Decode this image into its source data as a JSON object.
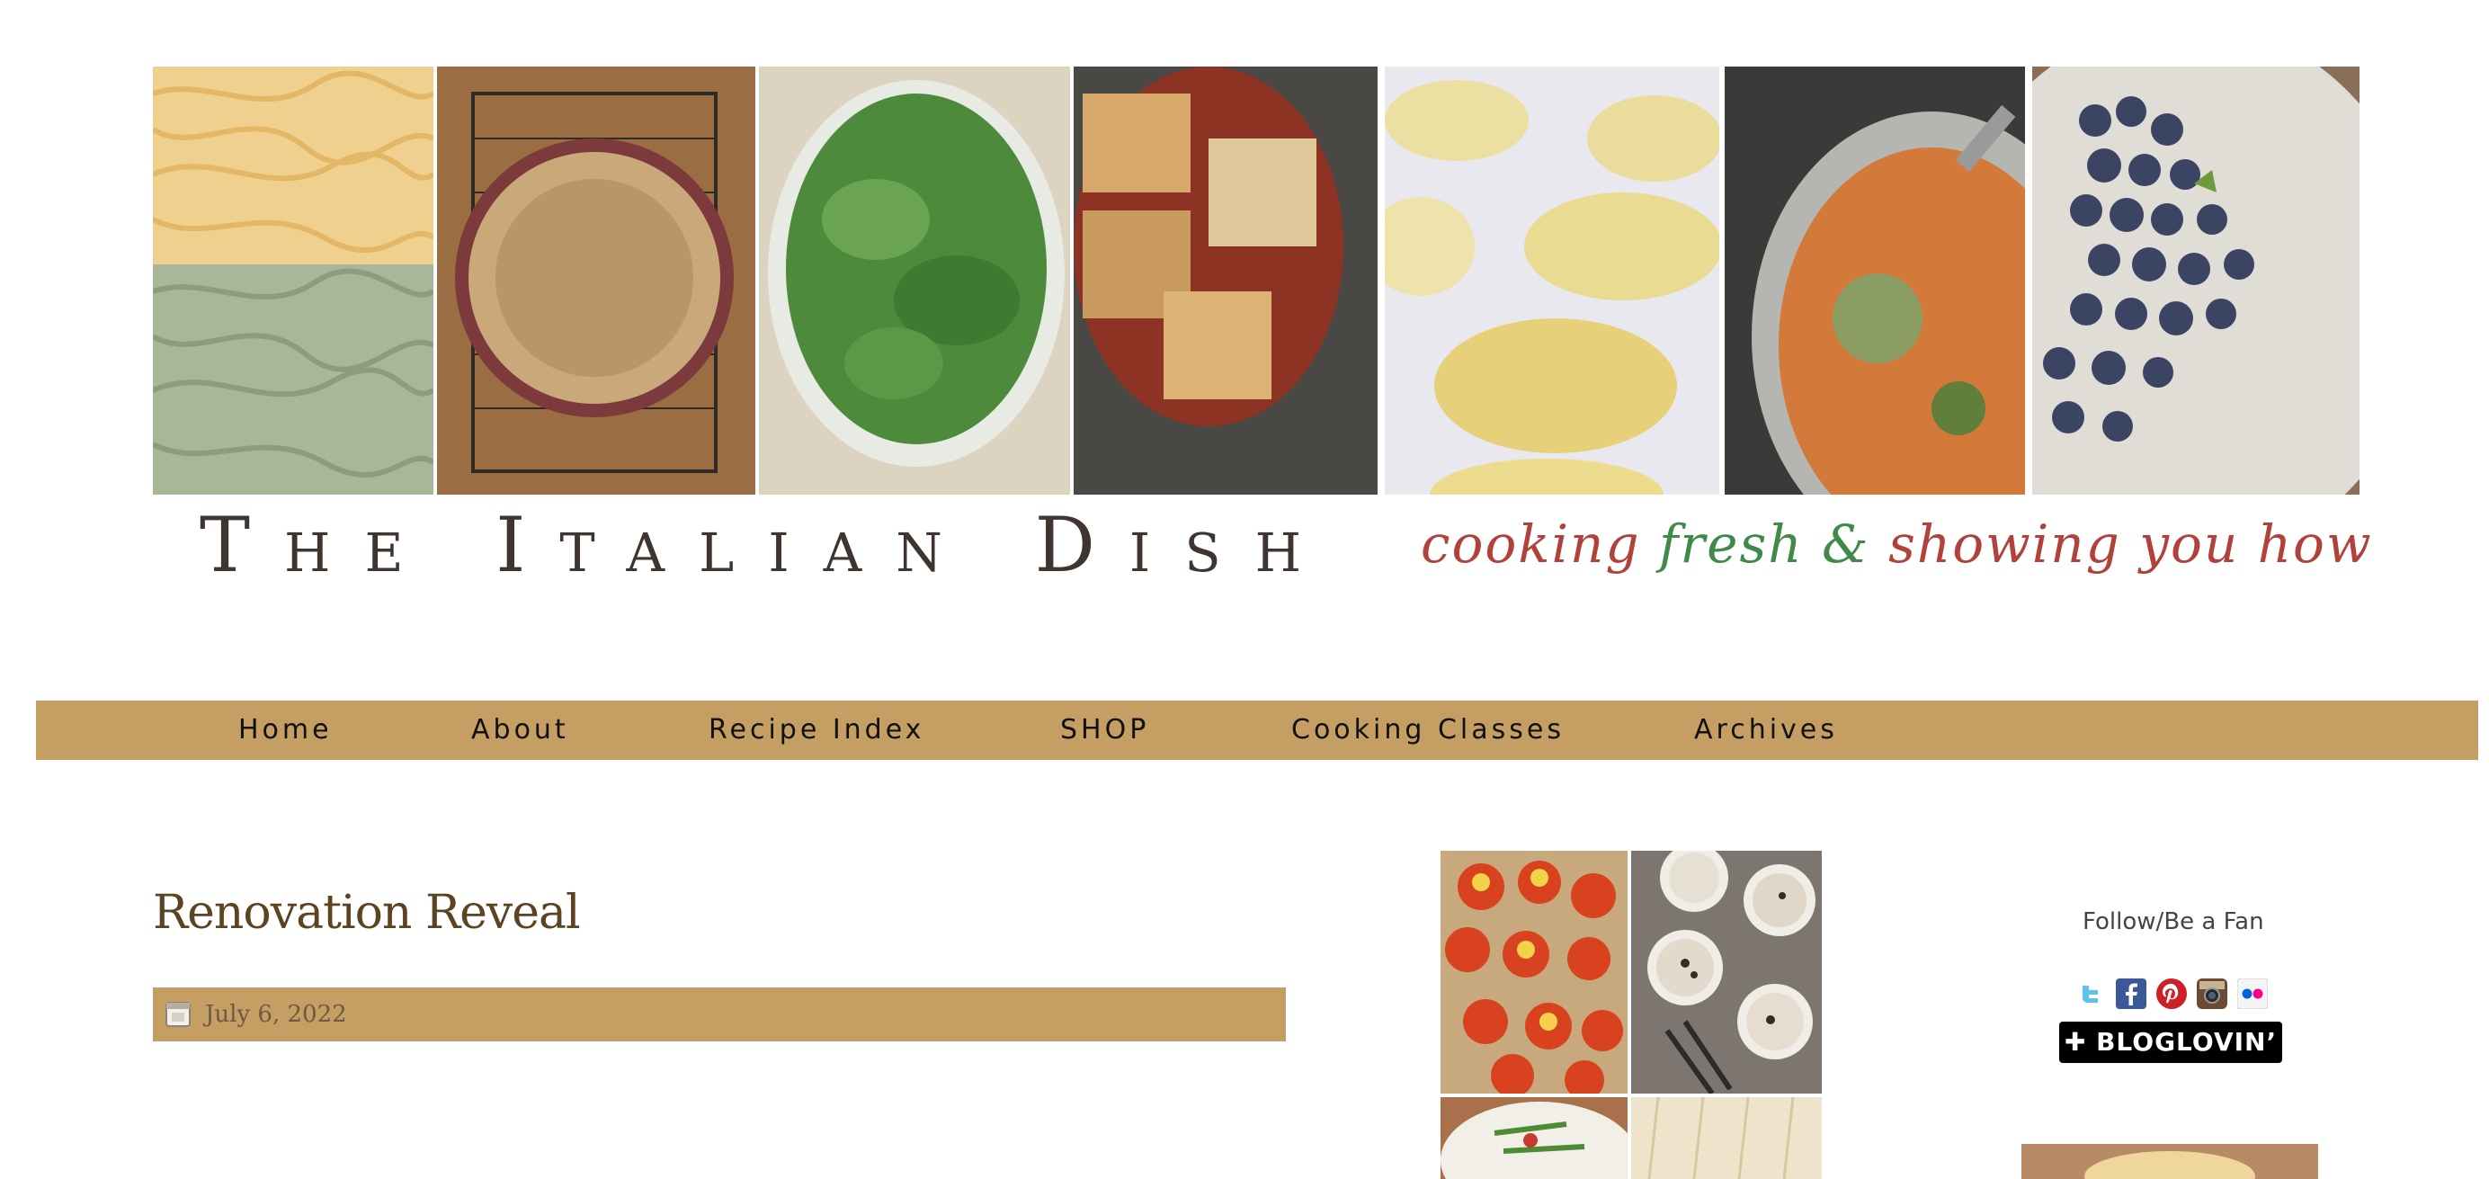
{
  "header": {
    "site_title": "The Italian Dish",
    "tagline": "cooking fresh & showing you how",
    "tagline_green_part": "fresh &",
    "photos": [
      "pasta-photo",
      "pie-photo",
      "spinach-photo",
      "lasagna-photo",
      "pasta-rounds-photo",
      "soup-photo",
      "blueberries-photo"
    ]
  },
  "nav": {
    "items": [
      "Home",
      "About",
      "Recipe Index",
      "SHOP",
      "Cooking Classes",
      "Archives"
    ],
    "bg_color": "#c59e64"
  },
  "post": {
    "title": "Renovation Reveal",
    "date": "July 6, 2022",
    "date_icon": "calendar-icon"
  },
  "sidebar_right": {
    "follow_label": "Follow/Be a Fan",
    "social_icons": [
      "twitter-icon",
      "facebook-icon",
      "pinterest-icon",
      "instagram-icon",
      "flickr-icon"
    ],
    "bloglovin_label": "✚ BLOGLOVIN’"
  },
  "colors": {
    "title_brown": "#5c4322",
    "tagline_red": "#b1413a",
    "tagline_green": "#3f8a49"
  }
}
